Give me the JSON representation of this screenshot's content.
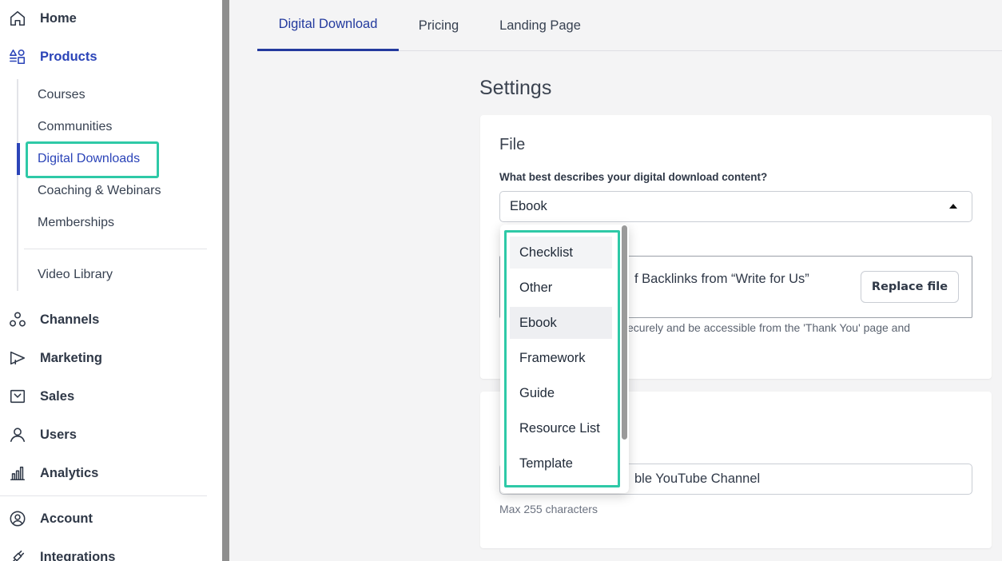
{
  "sidebar": {
    "home": "Home",
    "products": "Products",
    "sub_items": [
      "Courses",
      "Communities",
      "Digital Downloads",
      "Coaching & Webinars",
      "Memberships"
    ],
    "video_library": "Video Library",
    "channels": "Channels",
    "marketing": "Marketing",
    "sales": "Sales",
    "users": "Users",
    "analytics": "Analytics",
    "account": "Account",
    "integrations": "Integrations"
  },
  "tabs": [
    "Digital Download",
    "Pricing",
    "Landing Page"
  ],
  "settings": {
    "title": "Settings",
    "file_card": {
      "title": "File",
      "content_label": "What best describes your digital download content?",
      "selected_value": "Ebook",
      "file_name_visible": "f Backlinks from “Write for Us”",
      "replace_button": "Replace file",
      "help_text_visible": "ecurely and be accessible from the 'Thank You' page and"
    },
    "second_card": {
      "input_value_visible": "ble YouTube Channel",
      "max_chars": "Max 255 characters"
    }
  },
  "dropdown": {
    "options": [
      "Checklist",
      "Other",
      "Ebook",
      "Framework",
      "Guide",
      "Resource List",
      "Template"
    ]
  },
  "colors": {
    "accent": "#2b44b8",
    "highlight": "#2ec9a7"
  }
}
